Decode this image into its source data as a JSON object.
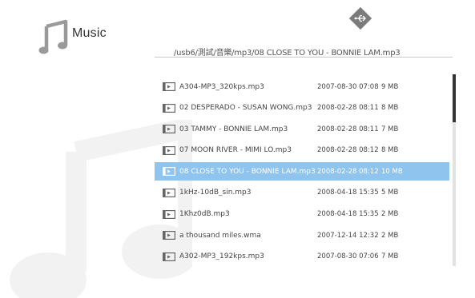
{
  "header": {
    "title": "Music",
    "path": "/usb6/測試/音樂/mp3/08 CLOSE TO YOU - BONNIE LAM.mp3"
  },
  "files": [
    {
      "name": "A304-MP3_320kps.mp3",
      "date": "2007-08-30 07:08",
      "size": "9 MB",
      "selected": false
    },
    {
      "name": "02 DESPERADO - SUSAN WONG.mp3",
      "date": "2008-02-28 08:11",
      "size": "8 MB",
      "selected": false
    },
    {
      "name": "03 TAMMY - BONNIE LAM.mp3",
      "date": "2008-02-28 08:11",
      "size": "7 MB",
      "selected": false
    },
    {
      "name": "07 MOON RIVER - MIMI LO.mp3",
      "date": "2008-02-28 08:12",
      "size": "8 MB",
      "selected": false
    },
    {
      "name": "08 CLOSE TO YOU - BONNIE LAM.mp3",
      "date": "2008-02-28 08:12",
      "size": "10 MB",
      "selected": true
    },
    {
      "name": "1kHz-10dB_sin.mp3",
      "date": "2008-04-18 15:35",
      "size": "5 MB",
      "selected": false
    },
    {
      "name": "1Khz0dB.mp3",
      "date": "2008-04-18 15:35",
      "size": "2 MB",
      "selected": false
    },
    {
      "name": "a thousand miles.wma",
      "date": "2007-12-14 12:32",
      "size": "2 MB",
      "selected": false
    },
    {
      "name": "A302-MP3_192kps.mp3",
      "date": "2007-08-30 07:06",
      "size": "7 MB",
      "selected": false
    }
  ],
  "scrollbar": {
    "position_fraction": 0.0,
    "visible_fraction": 0.25
  },
  "colors": {
    "selected_row": "#8fc4ef",
    "text": "#444444",
    "icon_border": "#666666"
  },
  "icons": {
    "app": "music-note-icon",
    "device": "usb-icon",
    "file": "audio-file-icon"
  }
}
